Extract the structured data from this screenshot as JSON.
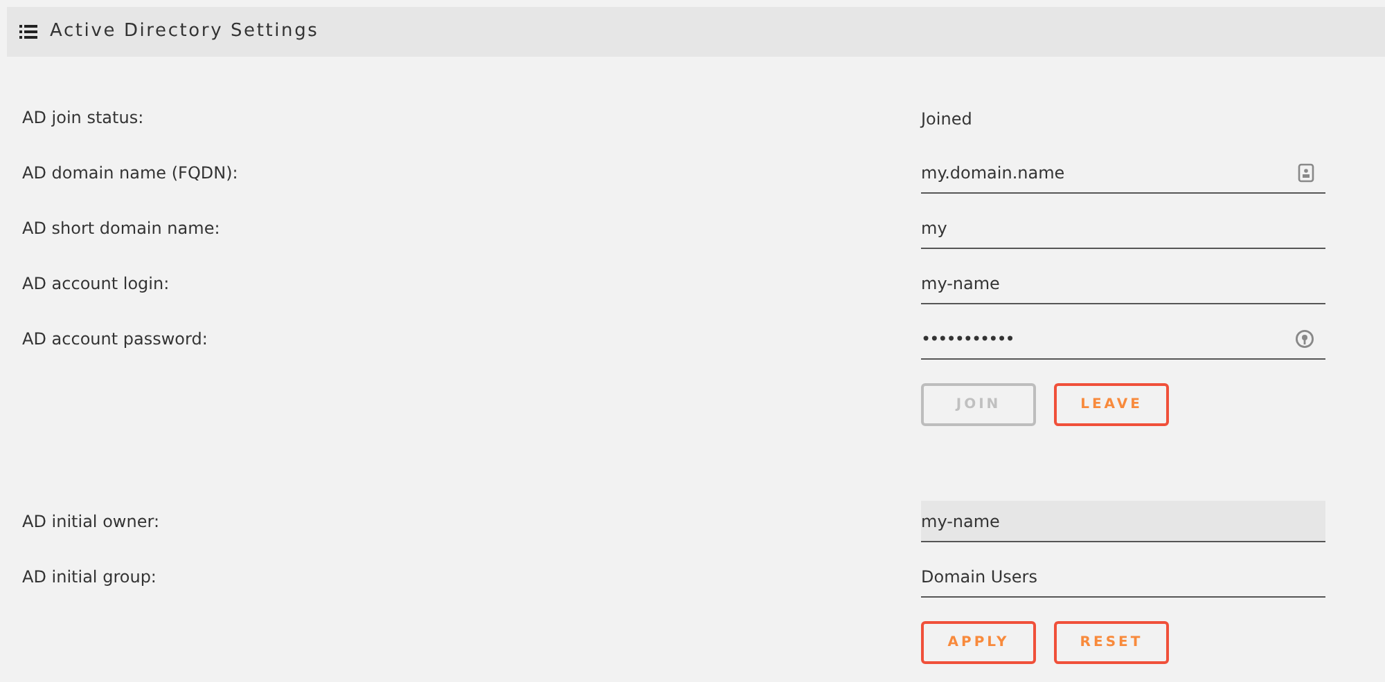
{
  "header": {
    "title": "Active Directory Settings"
  },
  "sections": [
    {
      "rows": [
        {
          "kind": "status",
          "label": "AD join status:",
          "value": "Joined"
        },
        {
          "kind": "contact",
          "label": "AD domain name (FQDN):",
          "value": "my.domain.name",
          "disabled": false
        },
        {
          "kind": "text",
          "label": "AD short domain name:",
          "value": "my",
          "disabled": false
        },
        {
          "kind": "text",
          "label": "AD account login:",
          "value": "my-name",
          "disabled": false
        },
        {
          "kind": "password",
          "label": "AD account password:",
          "value": "•••••••••••",
          "disabled": false
        }
      ],
      "buttons": [
        {
          "label": "JOIN",
          "disabled": true
        },
        {
          "label": "LEAVE",
          "disabled": false
        }
      ]
    },
    {
      "rows": [
        {
          "kind": "text",
          "label": "AD initial owner:",
          "value": "my-name",
          "disabled": true
        },
        {
          "kind": "text",
          "label": "AD initial group:",
          "value": "Domain Users",
          "disabled": false
        }
      ],
      "buttons": [
        {
          "label": "APPLY",
          "disabled": false
        },
        {
          "label": "RESET",
          "disabled": false
        }
      ]
    }
  ]
}
